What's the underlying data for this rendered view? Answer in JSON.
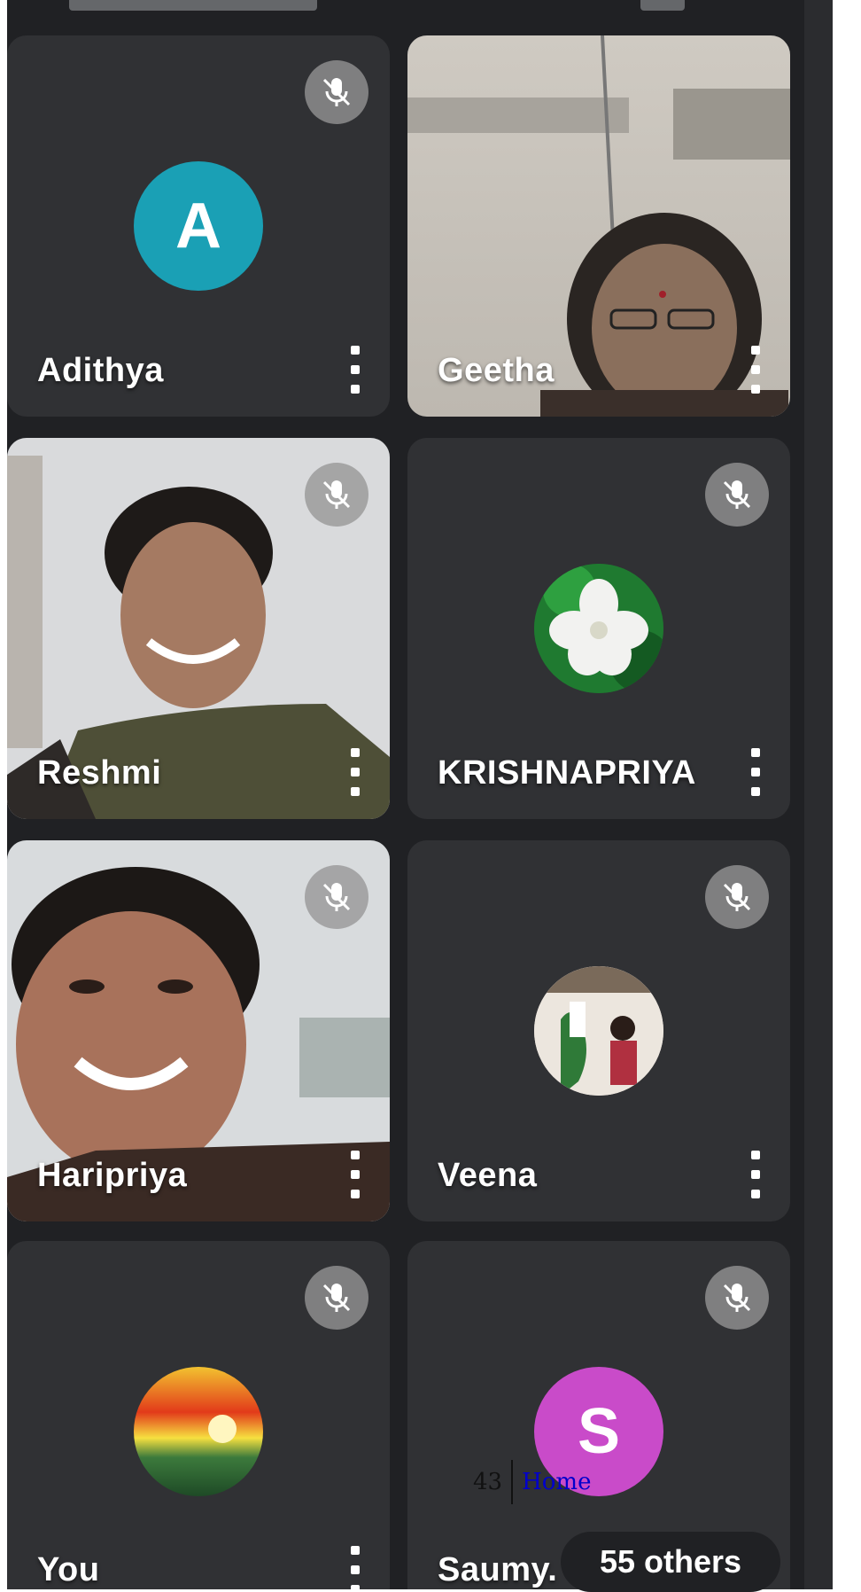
{
  "participants": [
    {
      "name": "Adithya",
      "initial": "A",
      "avatar_color": "#1aa0b5",
      "muted": true,
      "video": false
    },
    {
      "name": "Geetha",
      "muted": false,
      "video": true
    },
    {
      "name": "Reshmi",
      "muted": true,
      "video": true
    },
    {
      "name": "KRISHNAPRIYA",
      "muted": true,
      "video": false,
      "avatar_icon": "flower-avatar"
    },
    {
      "name": "Haripriya",
      "muted": true,
      "video": true
    },
    {
      "name": "Veena",
      "muted": true,
      "video": false,
      "avatar_icon": "photo-avatar"
    },
    {
      "name": "You",
      "muted": true,
      "video": false,
      "avatar_icon": "sunset-avatar"
    },
    {
      "name": "Saumy.",
      "initial": "S",
      "avatar_color": "#c94bc9",
      "muted": true,
      "video": false
    }
  ],
  "others_badge": "55 others",
  "footer": {
    "page_number": "43",
    "home_link": "Home"
  },
  "colors": {
    "background": "#202124",
    "tile": "#3c4043",
    "muted_icon": "#9a9a9a"
  }
}
